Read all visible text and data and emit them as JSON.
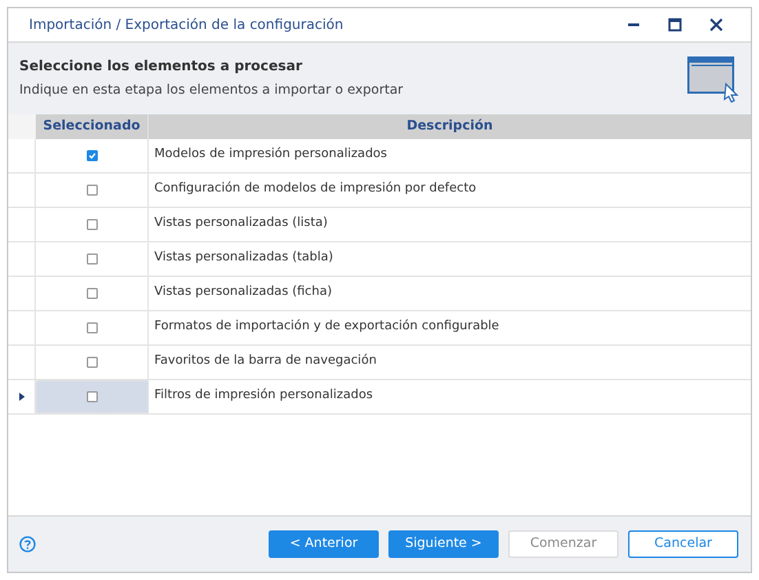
{
  "window": {
    "title": "Importación / Exportación de la configuración"
  },
  "header": {
    "title": "Seleccione los elementos a procesar",
    "subtitle": "Indique en esta etapa los elementos a importar o exportar"
  },
  "table": {
    "columns": [
      "Seleccionado",
      "Descripción"
    ],
    "rows": [
      {
        "checked": true,
        "current": false,
        "description": "Modelos de impresión personalizados"
      },
      {
        "checked": false,
        "current": false,
        "description": "Configuración de modelos de impresión por defecto"
      },
      {
        "checked": false,
        "current": false,
        "description": "Vistas personalizadas (lista)"
      },
      {
        "checked": false,
        "current": false,
        "description": "Vistas personalizadas (tabla)"
      },
      {
        "checked": false,
        "current": false,
        "description": "Vistas personalizadas (ficha)"
      },
      {
        "checked": false,
        "current": false,
        "description": "Formatos de importación y de exportación configurable"
      },
      {
        "checked": false,
        "current": false,
        "description": "Favoritos de la barra de navegación"
      },
      {
        "checked": false,
        "current": true,
        "description": "Filtros de impresión personalizados"
      }
    ]
  },
  "buttons": [
    {
      "label": "< Anterior",
      "kind": "primary"
    },
    {
      "label": "Siguiente >",
      "kind": "primary"
    },
    {
      "label": "Comenzar",
      "kind": "disabled"
    },
    {
      "label": "Cancelar",
      "kind": "default"
    }
  ]
}
